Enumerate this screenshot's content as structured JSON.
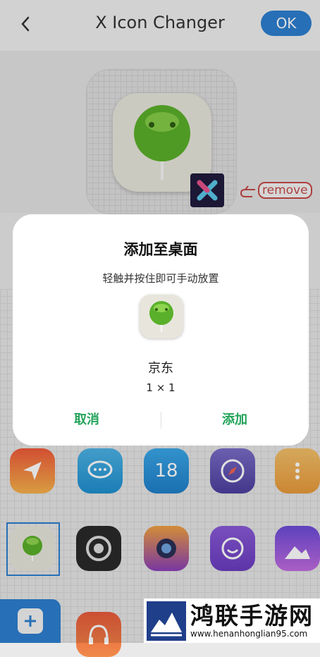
{
  "header": {
    "title": "X Icon Changer",
    "ok_label": "OK"
  },
  "preview": {
    "remove_label": "remove"
  },
  "dialog": {
    "title": "添加至桌面",
    "subtitle": "轻触并按住即可手动放置",
    "app_name": "京东",
    "size": "1 × 1",
    "cancel_label": "取消",
    "add_label": "添加",
    "accent_color": "#23a35a"
  },
  "icons": {
    "calendar_number": "18"
  },
  "watermark": {
    "name": "鸿联手游网",
    "url": "www.henanhonglian95.com"
  }
}
